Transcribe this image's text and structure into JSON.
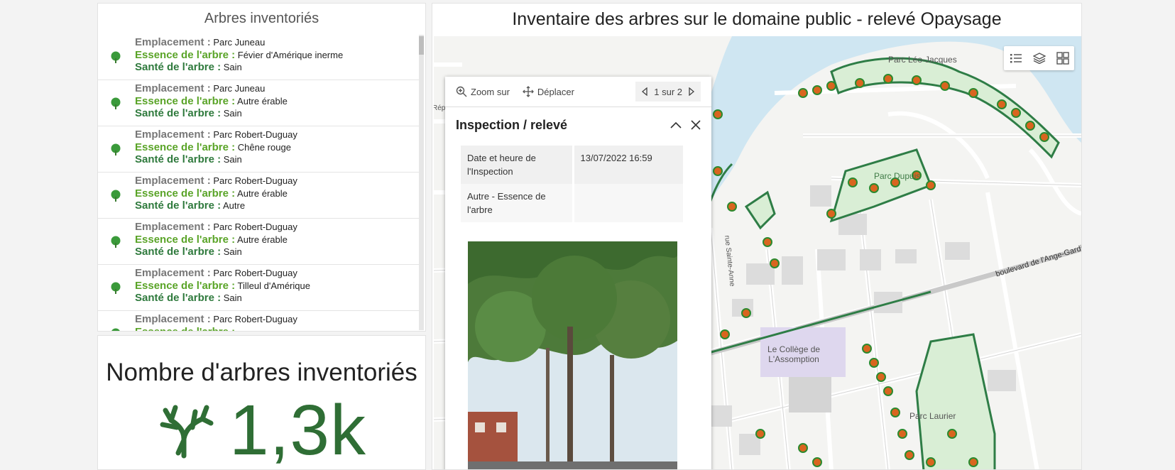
{
  "list": {
    "title": "Arbres inventoriés",
    "labels": {
      "location": "Emplacement :",
      "species": "Essence de l'arbre :",
      "health": "Santé de l'arbre :"
    },
    "items": [
      {
        "location": "Parc Juneau",
        "species": "Févier d'Amérique inerme",
        "health": "Sain"
      },
      {
        "location": "Parc Juneau",
        "species": "Autre érable",
        "health": "Sain"
      },
      {
        "location": "Parc Robert-Duguay",
        "species": "Chêne rouge",
        "health": "Sain"
      },
      {
        "location": "Parc Robert-Duguay",
        "species": "Autre érable",
        "health": "Autre"
      },
      {
        "location": "Parc Robert-Duguay",
        "species": "Autre érable",
        "health": "Sain"
      },
      {
        "location": "Parc Robert-Duguay",
        "species": "Tilleul d'Amérique",
        "health": "Sain"
      },
      {
        "location": "Parc Robert-Duguay",
        "species": "",
        "health": ""
      }
    ]
  },
  "indicator": {
    "title": "Nombre d'arbres inventoriés",
    "value": "1,3k",
    "icon": "tree-branch-icon"
  },
  "map": {
    "title": "Inventaire des arbres sur le domaine public - relevé Opaysage",
    "tools": [
      "legend-icon",
      "layers-icon",
      "basemap-gallery-icon"
    ],
    "labels": {
      "park_leo": "Parc Léo-Jacques",
      "park_dupuis": "Parc Dupuis",
      "street_anne": "rue Sainte-Anne",
      "boulevard": "boulevard de l'Ange-Gardien",
      "college": "Le Collège de\nL'Assomption",
      "park_laurier": "Parc Laurier",
      "edge_text": "Répu"
    },
    "colors": {
      "park_line": "#2e7d46",
      "water": "#cfe6f2",
      "tree": "#d9651f"
    }
  },
  "popup": {
    "zoom_label": "Zoom sur",
    "move_label": "Déplacer",
    "pager": "1 sur 2",
    "title": "Inspection / relevé",
    "attributes": [
      {
        "key": "Date et heure de l'Inspection",
        "value": "13/07/2022 16:59"
      },
      {
        "key": "Autre - Essence de l'arbre",
        "value": ""
      }
    ]
  }
}
